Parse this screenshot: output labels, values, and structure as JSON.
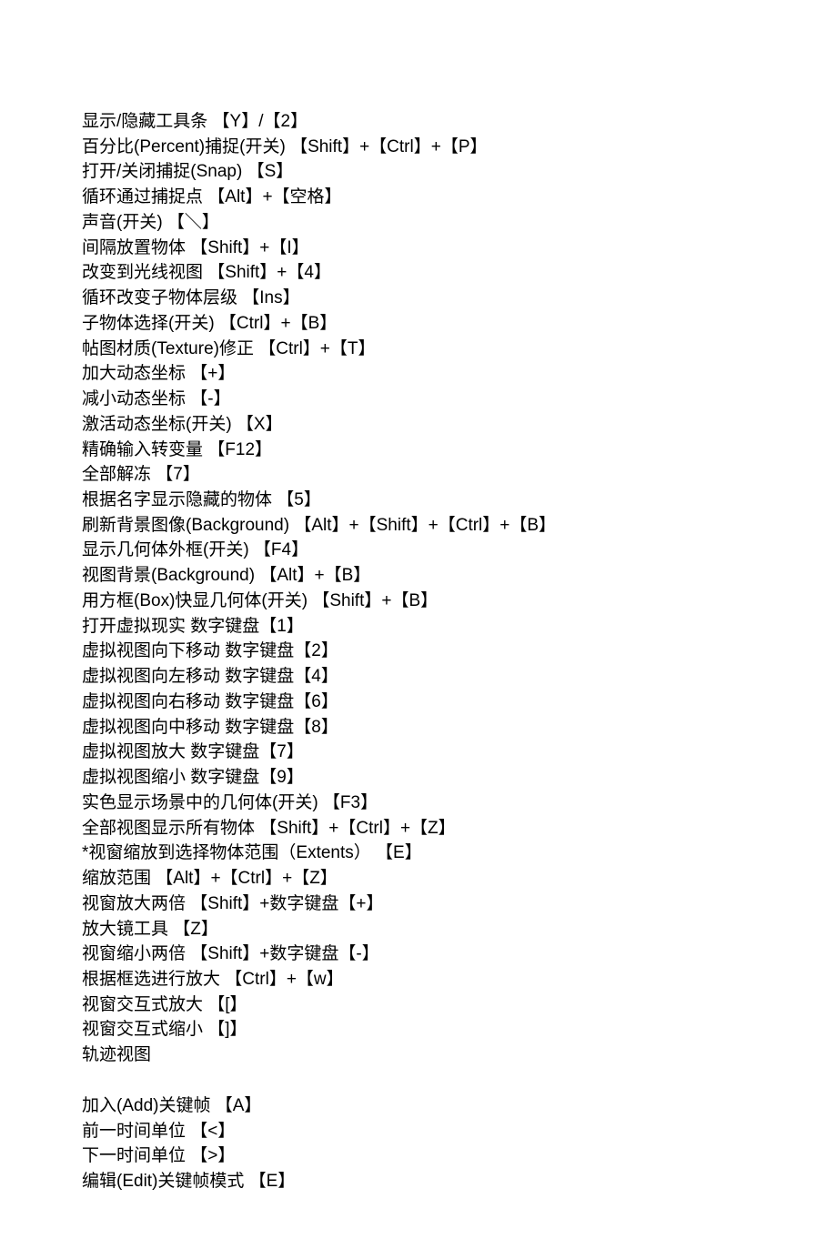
{
  "lines": [
    "显示/隐藏工具条 【Y】/【2】",
    "百分比(Percent)捕捉(开关) 【Shift】+【Ctrl】+【P】",
    "打开/关闭捕捉(Snap) 【S】",
    "循环通过捕捉点 【Alt】+【空格】",
    "声音(开关) 【＼】",
    "间隔放置物体 【Shift】+【I】",
    "改变到光线视图 【Shift】+【4】",
    "循环改变子物体层级 【Ins】",
    "子物体选择(开关) 【Ctrl】+【B】",
    "帖图材质(Texture)修正 【Ctrl】+【T】",
    "加大动态坐标 【+】",
    "减小动态坐标 【-】",
    "激活动态坐标(开关) 【X】",
    "精确输入转变量 【F12】",
    "全部解冻 【7】",
    "根据名字显示隐藏的物体 【5】",
    "刷新背景图像(Background) 【Alt】+【Shift】+【Ctrl】+【B】",
    "显示几何体外框(开关) 【F4】",
    "视图背景(Background) 【Alt】+【B】",
    "用方框(Box)快显几何体(开关) 【Shift】+【B】",
    "打开虚拟现实  数字键盘【1】",
    "虚拟视图向下移动  数字键盘【2】",
    "虚拟视图向左移动  数字键盘【4】",
    "虚拟视图向右移动  数字键盘【6】",
    "虚拟视图向中移动  数字键盘【8】",
    "虚拟视图放大  数字键盘【7】",
    "虚拟视图缩小  数字键盘【9】",
    "实色显示场景中的几何体(开关) 【F3】",
    "全部视图显示所有物体 【Shift】+【Ctrl】+【Z】",
    "*视窗缩放到选择物体范围（Extents） 【E】",
    "缩放范围 【Alt】+【Ctrl】+【Z】",
    "视窗放大两倍 【Shift】+数字键盘【+】",
    "放大镜工具 【Z】",
    "视窗缩小两倍 【Shift】+数字键盘【-】",
    "根据框选进行放大 【Ctrl】+【w】",
    "视窗交互式放大 【[】",
    "视窗交互式缩小 【]】",
    "轨迹视图"
  ],
  "lines2": [
    "加入(Add)关键帧 【A】",
    "前一时间单位 【<】",
    "下一时间单位 【>】",
    "编辑(Edit)关键帧模式 【E】"
  ]
}
